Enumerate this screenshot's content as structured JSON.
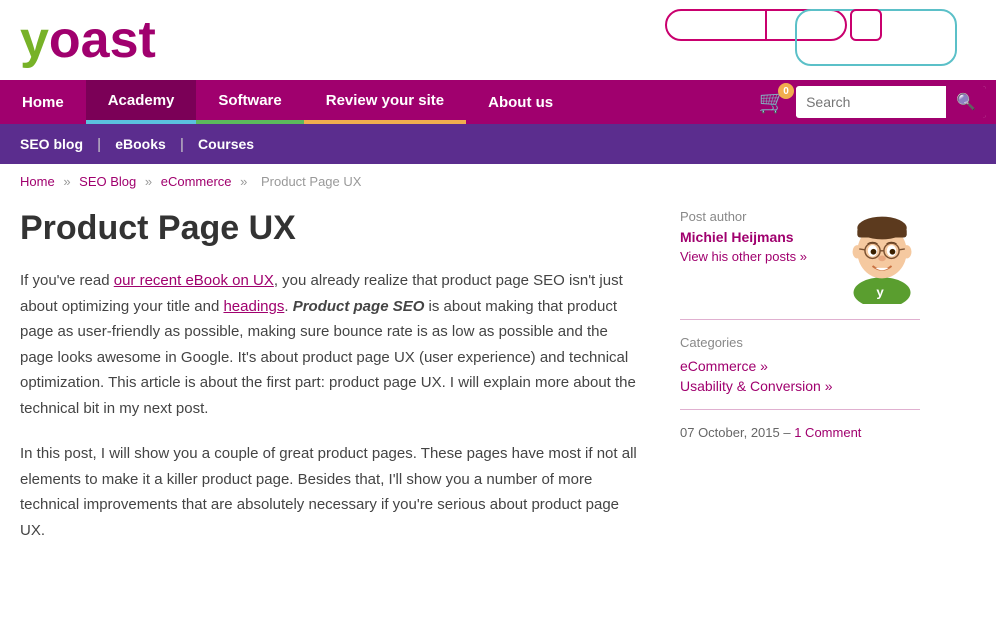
{
  "logo": {
    "y": "y",
    "oast": "oast"
  },
  "nav": {
    "items": [
      {
        "label": "Home",
        "active": false,
        "class": ""
      },
      {
        "label": "Academy",
        "active": true,
        "class": "active"
      },
      {
        "label": "Software",
        "active": false,
        "class": "software-item"
      },
      {
        "label": "Review your site",
        "active": false,
        "class": "review-item"
      },
      {
        "label": "About us",
        "active": false,
        "class": ""
      }
    ],
    "cart_count": "0",
    "search_placeholder": "Search"
  },
  "subnav": {
    "items": [
      {
        "label": "SEO blog"
      },
      {
        "label": "eBooks"
      },
      {
        "label": "Courses"
      }
    ]
  },
  "breadcrumb": {
    "items": [
      {
        "label": "Home",
        "href": "#"
      },
      {
        "label": "SEO Blog",
        "href": "#"
      },
      {
        "label": "eCommerce",
        "href": "#"
      },
      {
        "label": "Product Page UX",
        "href": "#"
      }
    ]
  },
  "article": {
    "title": "Product Page UX",
    "paragraphs": [
      {
        "html_parts": [
          {
            "type": "text",
            "content": "If you've read "
          },
          {
            "type": "link",
            "content": "our recent eBook on UX",
            "href": "#"
          },
          {
            "type": "text",
            "content": ", you already realize that product page SEO isn't just about optimizing your title and "
          },
          {
            "type": "link",
            "content": "headings",
            "href": "#"
          },
          {
            "type": "text",
            "content": ". "
          },
          {
            "type": "italic",
            "content": "Product page SEO"
          },
          {
            "type": "text",
            "content": " is about making that product page as user-friendly as possible, making sure bounce rate is as low as possible and the page looks awesome in Google. It's about product page UX (user experience) and technical optimization. This article is about the first part: product page UX. I will explain more about the technical bit in my next post."
          }
        ]
      },
      {
        "html_parts": [
          {
            "type": "text",
            "content": "In this post, I will show you a couple of great product pages. These pages have most if not all elements to make it a killer product page. Besides that, I'll show you a number of more technical improvements that are absolutely necessary if you're serious about product page UX."
          }
        ]
      }
    ]
  },
  "sidebar": {
    "post_author_label": "Post author",
    "author_name": "Michiel Heijmans",
    "view_posts": "View his other posts »",
    "categories_label": "Categories",
    "categories": [
      {
        "label": "eCommerce »",
        "href": "#"
      },
      {
        "label": "Usability & Conversion »",
        "href": "#"
      }
    ],
    "date": "07 October, 2015",
    "comment_label": "1 Comment"
  }
}
